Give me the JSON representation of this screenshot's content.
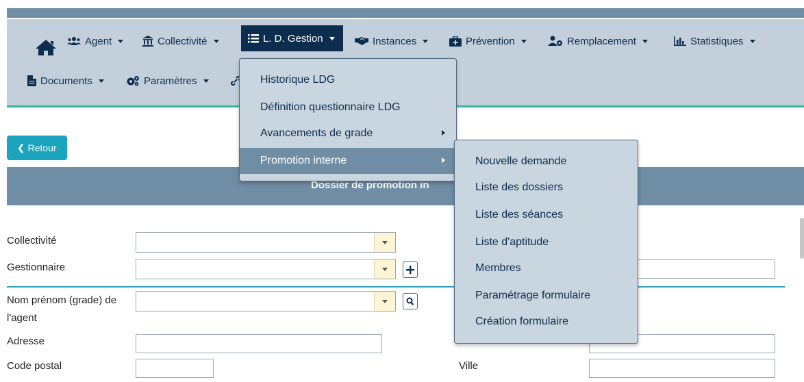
{
  "colors": {
    "nav_bg": "#c3d0dc",
    "nav_text": "#0d2d4e",
    "active_bg": "#0d2d4e",
    "accent": "#35b697",
    "header_bar": "#6f8ea6",
    "retour_button": "#1aa4bd",
    "select_arrow_bg": "#fdf4d6"
  },
  "nav": {
    "home_icon": "home-icon",
    "items": [
      {
        "label": "Agent",
        "icon": "users-icon"
      },
      {
        "label": "Collectivité",
        "icon": "institution-icon"
      },
      {
        "label": "L. D. Gestion",
        "icon": "list-icon",
        "active": true
      },
      {
        "label": "Instances",
        "icon": "handshake-icon"
      },
      {
        "label": "Prévention",
        "icon": "medkit-icon"
      },
      {
        "label": "Remplacement",
        "icon": "user-cog-icon"
      },
      {
        "label": "Statistiques",
        "icon": "bar-chart-icon"
      },
      {
        "label": "Documents",
        "icon": "file-icon"
      },
      {
        "label": "Paramètres",
        "icon": "cogs-icon"
      }
    ]
  },
  "ldg_menu": {
    "items": [
      {
        "label": "Historique LDG"
      },
      {
        "label": "Définition questionnaire LDG"
      },
      {
        "label": "Avancements de grade",
        "has_submenu": true
      },
      {
        "label": "Promotion interne",
        "has_submenu": true,
        "selected": true
      }
    ]
  },
  "promotion_submenu": {
    "items": [
      "Nouvelle demande",
      "Liste des dossiers",
      "Liste des séances",
      "Liste d'aptitude",
      "Membres",
      "Paramétrage formulaire",
      "Création formulaire"
    ]
  },
  "retour_button": "Retour",
  "section": {
    "title": "Dossier de promotion in"
  },
  "form": {
    "collectivite": {
      "label": "Collectivité",
      "value": ""
    },
    "gestionnaire": {
      "label": "Gestionnaire",
      "value": ""
    },
    "nom_prenom": {
      "label_line1": "Nom prénom (grade) de",
      "label_line2": "l'agent",
      "value": ""
    },
    "adresse": {
      "label": "Adresse",
      "value": ""
    },
    "code_postal": {
      "label": "Code postal",
      "value": ""
    },
    "ville": {
      "label": "Ville",
      "value": ""
    },
    "adresse_suite": {
      "value": ""
    },
    "right_field": {
      "value": ""
    }
  }
}
